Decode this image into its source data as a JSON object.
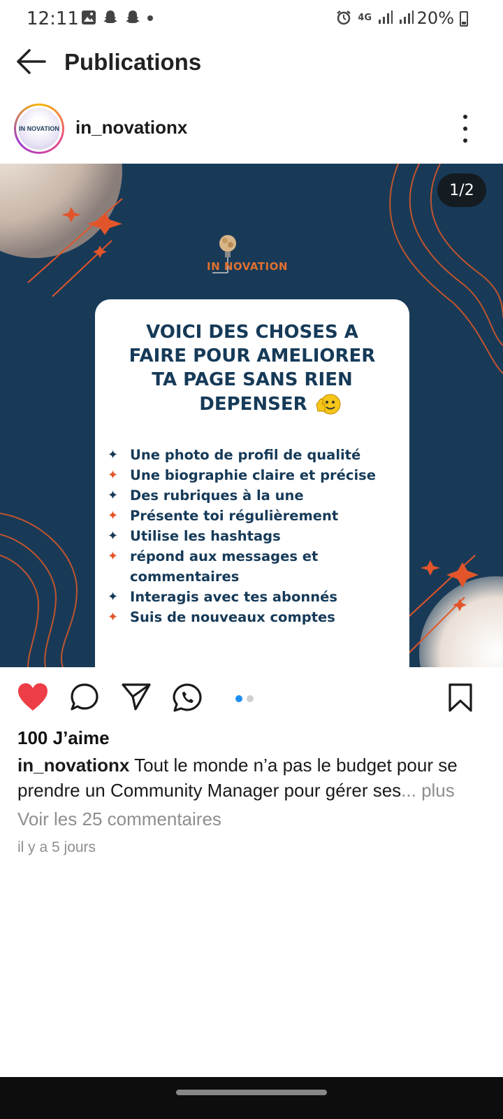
{
  "status_bar": {
    "time": "12:11",
    "network": "4G",
    "battery": "20%"
  },
  "app_bar": {
    "title": "Publications"
  },
  "post": {
    "username": "in_novationx",
    "avatar_text": "IN NOVATION",
    "counter": "1/2",
    "image": {
      "logo_text": "IN NOVATION",
      "title_lines": [
        "VOICI DES CHOSES A",
        "FAIRE POUR AMELIORER",
        "TA PAGE SANS RIEN",
        "DEPENSER"
      ],
      "items": [
        "Une photo de profil de qualité",
        "Une biographie claire et précise",
        "Des rubriques à la une",
        "Présente toi régulièrement",
        "Utilise les hashtags",
        "répond aux messages et commentaires",
        "Interagis avec tes abonnés",
        "Suis de nouveaux comptes"
      ]
    },
    "likes": "100 J’aime",
    "caption_user": "in_novationx",
    "caption_text": " Tout le monde n’a pas le budget pour se prendre un Community  Manager pour gérer ses",
    "caption_more": "... plus",
    "comments_link": "Voir les 25 commentaires",
    "time_ago": "il y a 5 jours",
    "carousel": {
      "current": 1,
      "total": 2
    }
  },
  "colors": {
    "navy": "#183a57",
    "accent_orange": "#e2552a",
    "like_red": "#ed3e47",
    "dot_blue": "#1d8ef0"
  }
}
